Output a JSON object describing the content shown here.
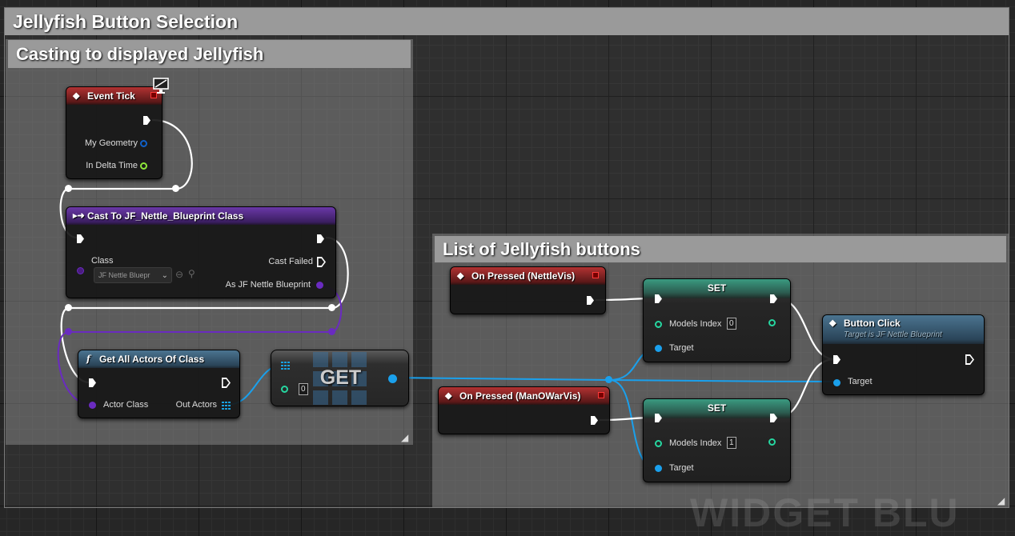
{
  "comments": {
    "outer_title": "Jellyfish Button Selection",
    "left_title": "Casting to displayed Jellyfish",
    "right_title": "List of Jellyfish buttons"
  },
  "event_tick": {
    "title": "Event Tick",
    "my_geometry": "My Geometry",
    "in_delta_time": "In Delta Time"
  },
  "cast_node": {
    "title": "Cast To JF_Nettle_Blueprint Class",
    "class_label": "Class",
    "class_value": "JF Nettle Bluepr",
    "cast_failed": "Cast Failed",
    "as_output": "As JF Nettle Blueprint"
  },
  "get_all_actors": {
    "title": "Get All Actors Of Class",
    "actor_class": "Actor Class",
    "out_actors": "Out Actors"
  },
  "get_node": {
    "title": "GET",
    "index_value": "0"
  },
  "on_pressed_nettle": {
    "title": "On Pressed (NettleVis)"
  },
  "on_pressed_manowar": {
    "title": "On Pressed (ManOWarVis)"
  },
  "set_node_1": {
    "title": "SET",
    "models_index": "Models Index",
    "value": "0",
    "target": "Target"
  },
  "set_node_2": {
    "title": "SET",
    "models_index": "Models Index",
    "value": "1",
    "target": "Target"
  },
  "button_click": {
    "title": "Button Click",
    "subtitle": "Target is JF Nettle Blueprint",
    "target": "Target"
  },
  "watermark": "WIDGET BLU",
  "colors": {
    "exec_wire": "#ffffff",
    "object_wire": "#1aa0ec",
    "class_wire": "#6a2bc0",
    "int_pin": "#26d6a0",
    "struct_pin": "#1060c8",
    "float_pin": "#8ee83a"
  }
}
